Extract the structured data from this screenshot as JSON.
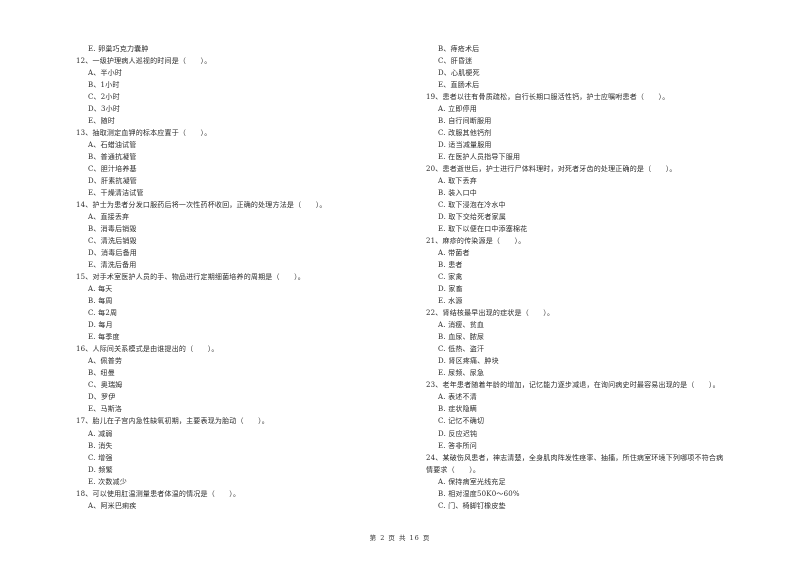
{
  "page": {
    "footer": "第 2 页 共 16 页"
  },
  "left_column": {
    "lines": [
      {
        "type": "opt",
        "text": "E. 卵巢巧克力囊肿"
      },
      {
        "type": "q",
        "text": "12、一级护理病人巡视的时间是（　　）。"
      },
      {
        "type": "opt",
        "text": "A、半小时"
      },
      {
        "type": "opt",
        "text": "B、1小时"
      },
      {
        "type": "opt",
        "text": "C、2小时"
      },
      {
        "type": "opt",
        "text": "D、3小时"
      },
      {
        "type": "opt",
        "text": "E、随时"
      },
      {
        "type": "q",
        "text": "13、抽取测定血钾的标本应置于（　　）。"
      },
      {
        "type": "opt",
        "text": "A、石蜡油试管"
      },
      {
        "type": "opt",
        "text": "B、普通抗凝管"
      },
      {
        "type": "opt",
        "text": "C、胆汁培养基"
      },
      {
        "type": "opt",
        "text": "D、肝素抗凝管"
      },
      {
        "type": "opt",
        "text": "E、干燥清洁试管"
      },
      {
        "type": "q",
        "text": "14、护士为患者分发口服药后将一次性药杯收回，正确的处理方法是（　　）。"
      },
      {
        "type": "opt",
        "text": "A、直接丢弃"
      },
      {
        "type": "opt",
        "text": "B、消毒后销毁"
      },
      {
        "type": "opt",
        "text": "C、清洗后销毁"
      },
      {
        "type": "opt",
        "text": "D、消毒后备用"
      },
      {
        "type": "opt",
        "text": "E、清洗后备用"
      },
      {
        "type": "q",
        "text": "15、对手术室医护人员的手、物品进行定期细菌培养的周期是（　　）。"
      },
      {
        "type": "opt",
        "text": "A. 每天"
      },
      {
        "type": "opt",
        "text": "B. 每周"
      },
      {
        "type": "opt",
        "text": "C. 每2周"
      },
      {
        "type": "opt",
        "text": "D. 每月"
      },
      {
        "type": "opt",
        "text": "E. 每季度"
      },
      {
        "type": "q",
        "text": "16、人际间关系模式是由谁提出的（　　）。"
      },
      {
        "type": "opt",
        "text": "A、佩普劳"
      },
      {
        "type": "opt",
        "text": "B、纽曼"
      },
      {
        "type": "opt",
        "text": "C、奥瑞姆"
      },
      {
        "type": "opt",
        "text": "D、罗伊"
      },
      {
        "type": "opt",
        "text": "E、马斯洛"
      },
      {
        "type": "q",
        "text": "17、胎儿在子宫内急性缺氧初期，主要表现为胎动（　　）。"
      },
      {
        "type": "opt",
        "text": "A. 减弱"
      },
      {
        "type": "opt",
        "text": "B. 消失"
      },
      {
        "type": "opt",
        "text": "C. 增强"
      },
      {
        "type": "opt",
        "text": "D. 频繁"
      },
      {
        "type": "opt",
        "text": "E. 次数减少"
      },
      {
        "type": "q",
        "text": "18、可以使用肛温测量患者体温的情况是（　　）。"
      },
      {
        "type": "opt",
        "text": "A、阿米巴痢疾"
      }
    ]
  },
  "right_column": {
    "lines": [
      {
        "type": "opt",
        "text": "B、痔疮术后"
      },
      {
        "type": "opt",
        "text": "C、肝昏迷"
      },
      {
        "type": "opt",
        "text": "D、心肌梗死"
      },
      {
        "type": "opt",
        "text": "E、直肠术后"
      },
      {
        "type": "q",
        "text": "19、患者以往有骨质疏松，自行长期口服活性钙，护士应嘱咐患者（　　）。"
      },
      {
        "type": "opt",
        "text": "A. 立即停用"
      },
      {
        "type": "opt",
        "text": "B. 自行间断服用"
      },
      {
        "type": "opt",
        "text": "C. 改服其他钙剂"
      },
      {
        "type": "opt",
        "text": "D. 适当减量服用"
      },
      {
        "type": "opt",
        "text": "E. 在医护人员指导下服用"
      },
      {
        "type": "q",
        "text": "20、患者逝世后，护士进行尸体料理时，对死者牙齿的处理正确的是（　　）。"
      },
      {
        "type": "opt",
        "text": "A. 取下丢弃"
      },
      {
        "type": "opt",
        "text": "B. 装入口中"
      },
      {
        "type": "opt",
        "text": "C. 取下浸泡在冷水中"
      },
      {
        "type": "opt",
        "text": "D. 取下交给死者家属"
      },
      {
        "type": "opt",
        "text": "E. 取下以便在口中添塞棉花"
      },
      {
        "type": "q",
        "text": "21、麻疹的传染源是（　　）。"
      },
      {
        "type": "opt",
        "text": "A. 带菌者"
      },
      {
        "type": "opt",
        "text": "B. 患者"
      },
      {
        "type": "opt",
        "text": "C. 家禽"
      },
      {
        "type": "opt",
        "text": "D. 家畜"
      },
      {
        "type": "opt",
        "text": "E. 水源"
      },
      {
        "type": "q",
        "text": "22、肾结核最早出现的症状是（　　）。"
      },
      {
        "type": "opt",
        "text": "A. 消瘦、贫血"
      },
      {
        "type": "opt",
        "text": "B. 血尿、脓尿"
      },
      {
        "type": "opt",
        "text": "C. 低热、盗汗"
      },
      {
        "type": "opt",
        "text": "D. 肾区疼痛、肿块"
      },
      {
        "type": "opt",
        "text": "E. 尿频、尿急"
      },
      {
        "type": "q",
        "text": "23、老年患者随着年龄的增加，记忆能力逐步减退，在询问病史时最容易出现的是（　　）。"
      },
      {
        "type": "opt",
        "text": "A. 表述不清"
      },
      {
        "type": "opt",
        "text": "B. 症状隐瞒"
      },
      {
        "type": "opt",
        "text": "C. 记忆不确切"
      },
      {
        "type": "opt",
        "text": "D. 反应迟钝"
      },
      {
        "type": "opt",
        "text": "E. 答非所问"
      },
      {
        "type": "q",
        "text": "24、某破伤风患者，神志清楚，全身肌肉阵发性痉挛、抽搐，所住病室环境下列哪项不符合病"
      },
      {
        "type": "cont",
        "text": "情要求（　　）。"
      },
      {
        "type": "opt",
        "text": "A. 保持病室光线充足"
      },
      {
        "type": "opt",
        "text": "B. 相对湿度50K0～60%"
      },
      {
        "type": "opt",
        "text": "C. 门、椅脚钉橡皮垫"
      }
    ]
  }
}
